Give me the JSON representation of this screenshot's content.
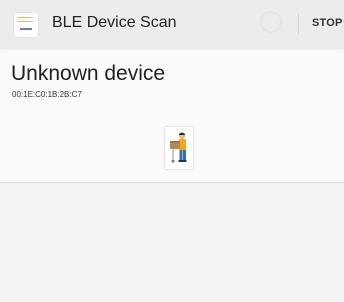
{
  "app_bar": {
    "title": "BLE Device Scan",
    "stop_label": "STOP",
    "app_icon": "app-logo-icon",
    "progress_indicator": "scanning-spinner"
  },
  "device_list": [
    {
      "name": "Unknown device",
      "address": "00:1E:C0:1B:2B:C7",
      "illustration": "person-with-box-illustration"
    }
  ],
  "colors": {
    "app_bar_bg": "#ececec",
    "background": "#fafafa",
    "text_primary": "#222222"
  }
}
